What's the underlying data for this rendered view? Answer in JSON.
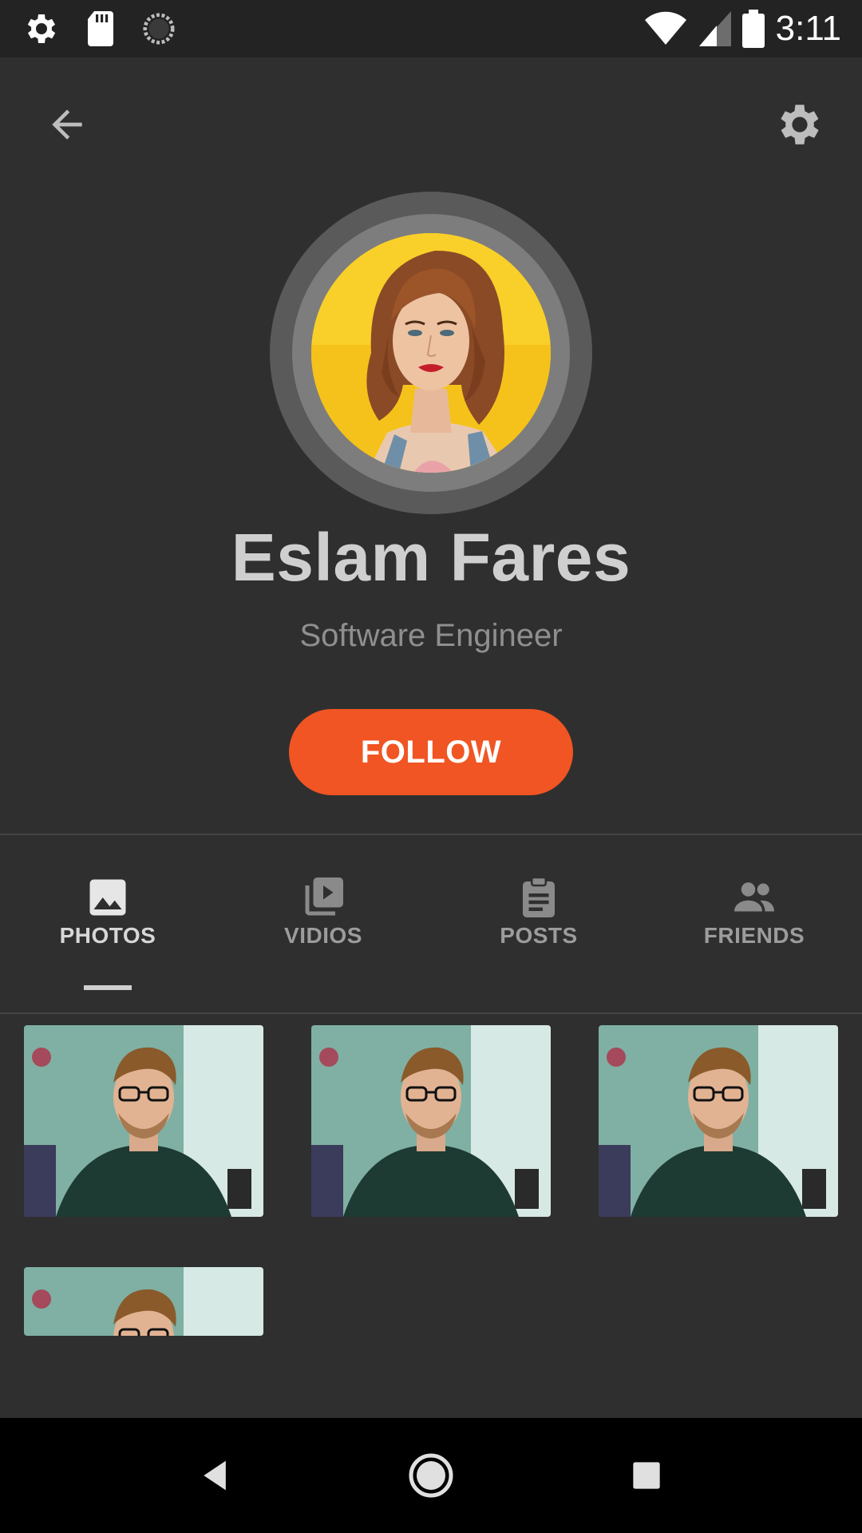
{
  "status_bar": {
    "time": "3:11",
    "left_icons": [
      "gear-icon",
      "sd-card-icon",
      "sync-icon"
    ],
    "right_icons": [
      "wifi-icon",
      "cell-signal-icon",
      "battery-icon"
    ]
  },
  "header": {
    "back_icon": "arrow-back-icon",
    "settings_icon": "gear-icon"
  },
  "profile": {
    "name": "Eslam Fares",
    "subtitle": "Software Engineer",
    "avatar_ring_colors": [
      "#5a5a5a",
      "#7d7d7d"
    ],
    "avatar_bg": "#f5c21b"
  },
  "follow_button": {
    "label": "FOLLOW",
    "color": "#f05523"
  },
  "tabs": [
    {
      "label": "PHOTOS",
      "icon": "image-icon",
      "active": true
    },
    {
      "label": "VIDIOS",
      "icon": "video-library-icon",
      "active": false
    },
    {
      "label": "POSTS",
      "icon": "clipboard-icon",
      "active": false
    },
    {
      "label": "FRIENDS",
      "icon": "people-icon",
      "active": false
    }
  ],
  "photos": {
    "count_visible": 4
  },
  "nav_bar": {
    "buttons": [
      "back-triangle-icon",
      "home-circle-icon",
      "recents-square-icon"
    ]
  }
}
